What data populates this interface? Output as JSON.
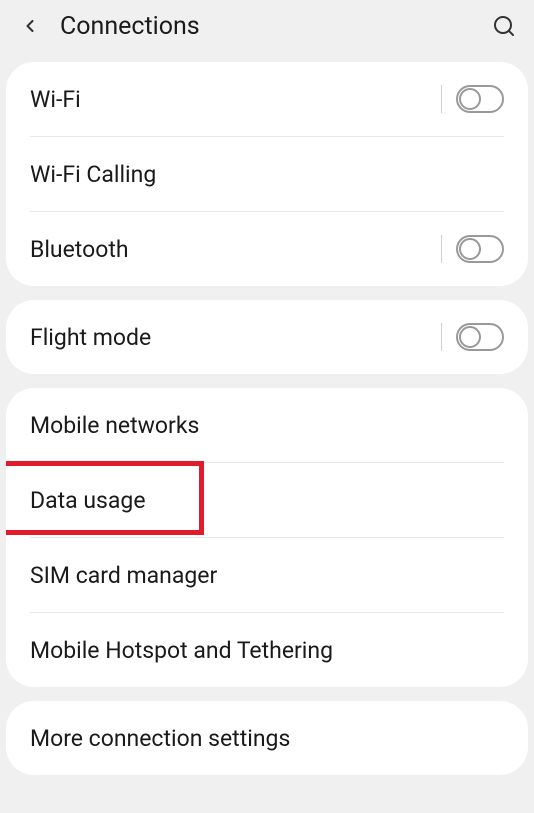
{
  "header": {
    "title": "Connections"
  },
  "groups": [
    {
      "id": "g1",
      "items": [
        {
          "id": "wifi",
          "label": "Wi-Fi",
          "toggle": true,
          "on": false
        },
        {
          "id": "wifiCalling",
          "label": "Wi-Fi Calling",
          "toggle": false
        },
        {
          "id": "bluetooth",
          "label": "Bluetooth",
          "toggle": true,
          "on": false
        }
      ]
    },
    {
      "id": "g2",
      "items": [
        {
          "id": "flightMode",
          "label": "Flight mode",
          "toggle": true,
          "on": false
        }
      ]
    },
    {
      "id": "g3",
      "items": [
        {
          "id": "mobileNetworks",
          "label": "Mobile networks",
          "toggle": false
        },
        {
          "id": "dataUsage",
          "label": "Data usage",
          "toggle": false,
          "highlight": true
        },
        {
          "id": "simCard",
          "label": "SIM card manager",
          "toggle": false
        },
        {
          "id": "hotspot",
          "label": "Mobile Hotspot and Tethering",
          "toggle": false
        }
      ]
    },
    {
      "id": "g4",
      "items": [
        {
          "id": "moreConn",
          "label": "More connection settings",
          "toggle": false
        }
      ]
    }
  ]
}
